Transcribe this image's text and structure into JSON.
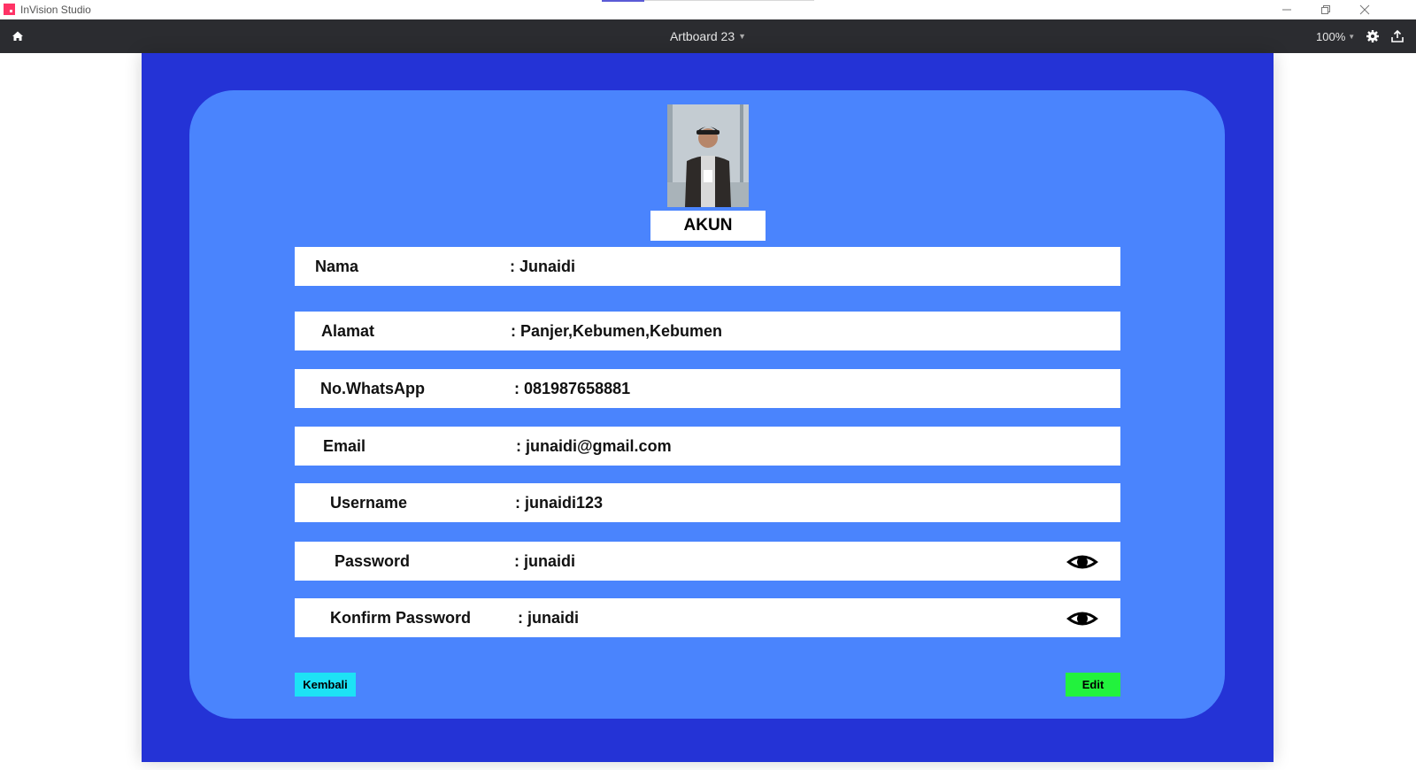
{
  "window": {
    "app_title": "InVision Studio",
    "minimize_icon": "minimize-icon",
    "restore_icon": "restore-icon",
    "close_icon": "close-icon"
  },
  "toolbar": {
    "artboard_name": "Artboard 23",
    "zoom": "100%",
    "icons": [
      "home-icon",
      "gear-icon",
      "share-icon"
    ]
  },
  "page": {
    "title": "AKUN",
    "fields": [
      {
        "label": "Nama",
        "value": ": Junaidi",
        "has_eye": false
      },
      {
        "label": "Alamat",
        "value": ": Panjer,Kebumen,Kebumen",
        "has_eye": false
      },
      {
        "label": "No.WhatsApp",
        "value": ": 081987658881",
        "has_eye": false
      },
      {
        "label": "Email",
        "value": ": junaidi@gmail.com",
        "has_eye": false
      },
      {
        "label": "Username",
        "value": ": junaidi123",
        "has_eye": false
      },
      {
        "label": "Password",
        "value": ": junaidi",
        "has_eye": true
      },
      {
        "label": "Konfirm Password",
        "value": ": junaidi",
        "has_eye": true
      }
    ],
    "back_button": "Kembali",
    "edit_button": "Edit"
  },
  "colors": {
    "artboard_bg": "#2433d6",
    "card_bg": "#4a84fd",
    "back_button": "#1de2f5",
    "edit_button": "#22f23d",
    "toolbar_bg": "#2b2c30",
    "app_logo": "#ff3366"
  }
}
